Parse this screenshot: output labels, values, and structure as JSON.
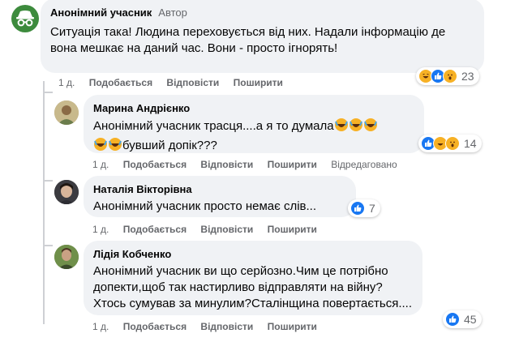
{
  "comments": [
    {
      "author": "Анонімний учасник",
      "badge": "Автор",
      "text": "Ситуація така! Людина переховується від них. Надали інформацію де вона мешкає на даний час. Вони - просто ігнорять!",
      "time": "1 д.",
      "like": "Подобається",
      "reply": "Відповісти",
      "share": "Поширити",
      "reaction_count": "23",
      "reactions": [
        "haha-icon",
        "like-icon",
        "wow-icon"
      ]
    },
    {
      "author": "Марина Андрієнко",
      "text_line1": "Анонімний учасник трасця....а я то думала",
      "text_line2": "бувший допік???",
      "time": "1 д.",
      "like": "Подобається",
      "reply": "Відповісти",
      "share": "Поширити",
      "edited": "Відредаговано",
      "reaction_count": "14",
      "reactions": [
        "like-icon",
        "haha-icon",
        "wow-icon"
      ]
    },
    {
      "author": "Наталія Вікторівна",
      "text": "Анонімний учасник просто немає слів...",
      "time": "1 д.",
      "like": "Подобається",
      "reply": "Відповісти",
      "share": "Поширити",
      "reaction_count": "7",
      "reactions": [
        "like-icon"
      ]
    },
    {
      "author": "Лідія Кобченко",
      "text": "Анонімний учасник ви що серйозно.Чим це потрібно допекти,щоб так настирливо відправляти на війну?Хтось сумував за минулим?Сталінщина повертається....",
      "time": "1 д.",
      "like": "Подобається",
      "reply": "Відповісти",
      "share": "Поширити",
      "reaction_count": "45",
      "reactions": [
        "like-icon"
      ]
    }
  ],
  "colors": {
    "facebook_blue": "#1877f2",
    "bubble_bg": "#f0f2f5",
    "meta_text": "#65676b",
    "reaction_yellow": "#f7b125"
  }
}
